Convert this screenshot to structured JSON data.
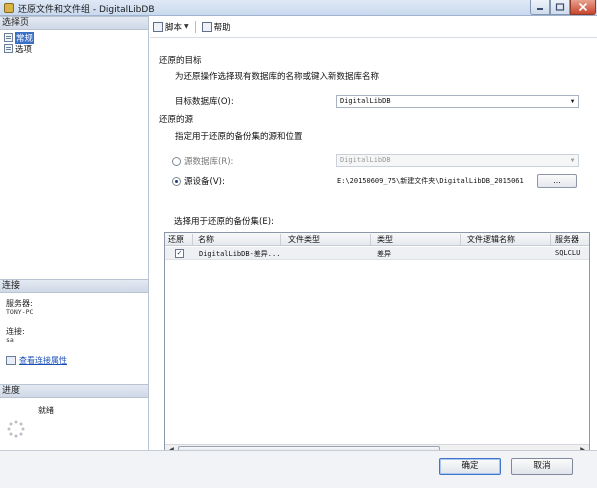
{
  "window": {
    "title": "还原文件和文件组 - DigitalLibDB"
  },
  "left_pane": {
    "select_page_header": "选择页",
    "pages": [
      {
        "label": "常规",
        "selected": true
      },
      {
        "label": "选项",
        "selected": false
      }
    ],
    "connection": {
      "header": "连接",
      "server_label": "服务器:",
      "server_value": "TONY-PC",
      "connection_label": "连接:",
      "connection_value": "sa",
      "view_properties_link": "查看连接属性"
    },
    "progress": {
      "header": "进度",
      "status": "就绪"
    }
  },
  "toolbar": {
    "script_label": "脚本",
    "help_label": "帮助"
  },
  "restore_target": {
    "section_label": "还原的目标",
    "instruction": "为还原操作选择现有数据库的名称或键入新数据库名称",
    "target_db_label": "目标数据库(O):",
    "target_db_value": "DigitalLibDB"
  },
  "restore_source": {
    "section_label": "还原的源",
    "instruction": "指定用于还原的备份集的源和位置",
    "source_db_label": "源数据库(R):",
    "source_db_value": "DigitalLibDB",
    "source_device_label": "源设备(V):",
    "source_device_path": "E:\\20150609_75\\新建文件夹\\DigitalLibDB_2015061",
    "browse_label": "...",
    "selected_option": "source_device"
  },
  "backup_sets": {
    "label": "选择用于还原的备份集(E):",
    "columns": [
      "还原",
      "名称",
      "文件类型",
      "类型",
      "文件逻辑名称",
      "服务器"
    ],
    "rows": [
      {
        "restore": true,
        "name": "DigitalLibDB-差异...",
        "file_type": "",
        "type": "差异",
        "logical_name": "",
        "server": "SQLCLU"
      }
    ]
  },
  "dialog_buttons": {
    "ok": "确定",
    "cancel": "取消"
  }
}
